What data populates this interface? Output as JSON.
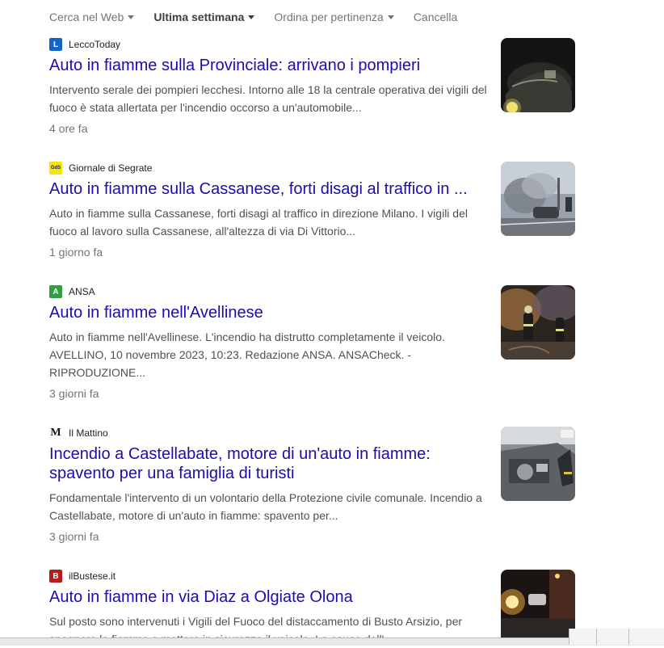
{
  "toolbar": {
    "items": [
      {
        "label": "Cerca nel Web"
      },
      {
        "label": "Ultima settimana"
      },
      {
        "label": "Ordina per pertinenza"
      },
      {
        "label": "Cancella"
      }
    ]
  },
  "results": [
    {
      "source": "LeccoToday",
      "favicon_text": "L",
      "favicon_bg": "#1565c0",
      "favicon_fg": "#ffffff",
      "title": "Auto in fiamme sulla Provinciale: arrivano i pompieri",
      "snippet": "Intervento serale dei pompieri lecchesi. Intorno alle 18 la centrale operativa dei vigili del fuoco è stata allertata per l'incendio occorso a un'automobile...",
      "time": "4 ore fa"
    },
    {
      "source": "Giornale di Segrate",
      "favicon_text": "GdS",
      "favicon_bg": "#f5e50a",
      "favicon_fg": "#222222",
      "title": "Auto in fiamme sulla Cassanese, forti disagi al traffico in ...",
      "snippet": "Auto in fiamme sulla Cassanese, forti disagi al traffico in direzione Milano. I vigili del fuoco al lavoro sulla Cassanese, all'altezza di via Di Vittorio...",
      "time": "1 giorno fa"
    },
    {
      "source": "ANSA",
      "favicon_text": "A",
      "favicon_bg": "#2ea043",
      "favicon_fg": "#ffffff",
      "title": "Auto in fiamme nell'Avellinese",
      "snippet": "Auto in fiamme nell'Avellinese. L'incendio ha distrutto completamente il veicolo. AVELLINO, 10 novembre 2023, 10:23. Redazione ANSA. ANSACheck. - RIPRODUZIONE...",
      "time": "3 giorni fa"
    },
    {
      "source": "Il Mattino",
      "favicon_text": "M",
      "favicon_bg": "#ffffff",
      "favicon_fg": "#111111",
      "title": "Incendio a Castellabate, motore di un'auto in fiamme: spavento per una famiglia di turisti",
      "snippet": "Fondamentale l'intervento di un volontario della Protezione civile comunale. Incendio a Castellabate, motore di un'auto in fiamme: spavento per...",
      "time": "3 giorni fa"
    },
    {
      "source": "ilBustese.it",
      "favicon_text": "B",
      "favicon_bg": "#b71c1c",
      "favicon_fg": "#ffffff",
      "title": "Auto in fiamme in via Diaz a Olgiate Olona",
      "snippet": "Sul posto sono intervenuti i Vigili del Fuoco del distaccamento di Busto Arsizio, per spegnere le fiamme e mettere in sicurezza il veicolo. Le cause dell'...",
      "time": ""
    }
  ]
}
